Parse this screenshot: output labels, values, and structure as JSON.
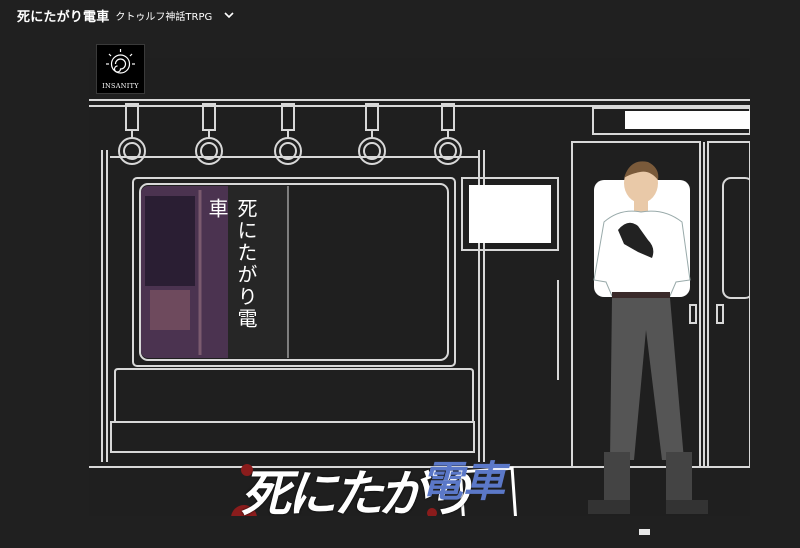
{
  "header": {
    "title": "死にたがり電車",
    "subtitle": "クトゥルフ神話TRPG"
  },
  "badge": {
    "label": "INSANITY"
  },
  "poster": {
    "vertical_title": "死にたがり電車"
  },
  "logo": {
    "main_text": "死にたがり",
    "accent_text": "電車"
  },
  "colors": {
    "background": "#202020",
    "stage": "#1f1f1f",
    "line_art": "#d8d8d8",
    "logo_blue": "#5b78c8",
    "blood_red": "#8a1c1c"
  },
  "icons": {
    "chevron": "chevron-down-icon",
    "badge": "spiral-icon"
  }
}
